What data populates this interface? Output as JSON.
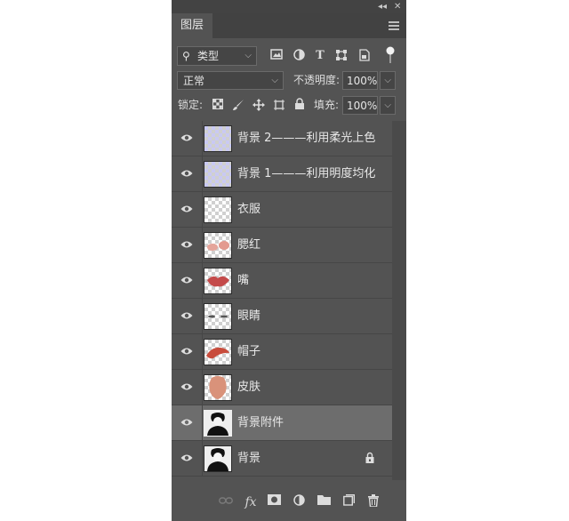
{
  "panel": {
    "collapse_glyph": "◂◂",
    "close_glyph": "✕",
    "tab_label": "图层",
    "menu_icon": "hamburger-icon"
  },
  "filter": {
    "kind_glyph": "⚲",
    "kind_label": "类型",
    "kind_chevron": "⌵",
    "icons": [
      "image-filter-icon",
      "adjustment-filter-icon",
      "type-filter-icon",
      "shape-filter-icon",
      "smart-object-filter-icon",
      "filter-toggle-icon"
    ],
    "type_glyph": "T"
  },
  "blend": {
    "mode": "正常",
    "chevron": "⌵",
    "opacity_label": "不透明度:",
    "opacity_value": "100%"
  },
  "lock": {
    "label": "锁定:",
    "fill_label": "填充:",
    "fill_value": "100%"
  },
  "layers": [
    {
      "name": "背景 2———利用柔光上色",
      "thumb": "blue"
    },
    {
      "name": "背景 1———利用明度均化",
      "thumb": "blue"
    },
    {
      "name": "衣服",
      "thumb": "checker"
    },
    {
      "name": "腮红",
      "thumb": "blush"
    },
    {
      "name": "嘴",
      "thumb": "lips"
    },
    {
      "name": "眼睛",
      "thumb": "eyes"
    },
    {
      "name": "帽子",
      "thumb": "hat"
    },
    {
      "name": "皮肤",
      "thumb": "skin"
    },
    {
      "name": "背景附件",
      "thumb": "photo",
      "selected": true
    },
    {
      "name": "背景",
      "thumb": "photo",
      "locked": true
    }
  ],
  "footer": {
    "fx_label": "fx",
    "icons": [
      "link-layers-icon",
      "fx-icon",
      "add-mask-icon",
      "adjustment-layer-icon",
      "new-group-icon",
      "new-layer-icon",
      "trash-icon"
    ]
  },
  "colors": {
    "panel_bg": "#535353",
    "selected_row": "#6d6d6d",
    "transparency_blue": "#c9c9f3",
    "lips_red": "#c44a4a",
    "skin": "#d9927a"
  }
}
